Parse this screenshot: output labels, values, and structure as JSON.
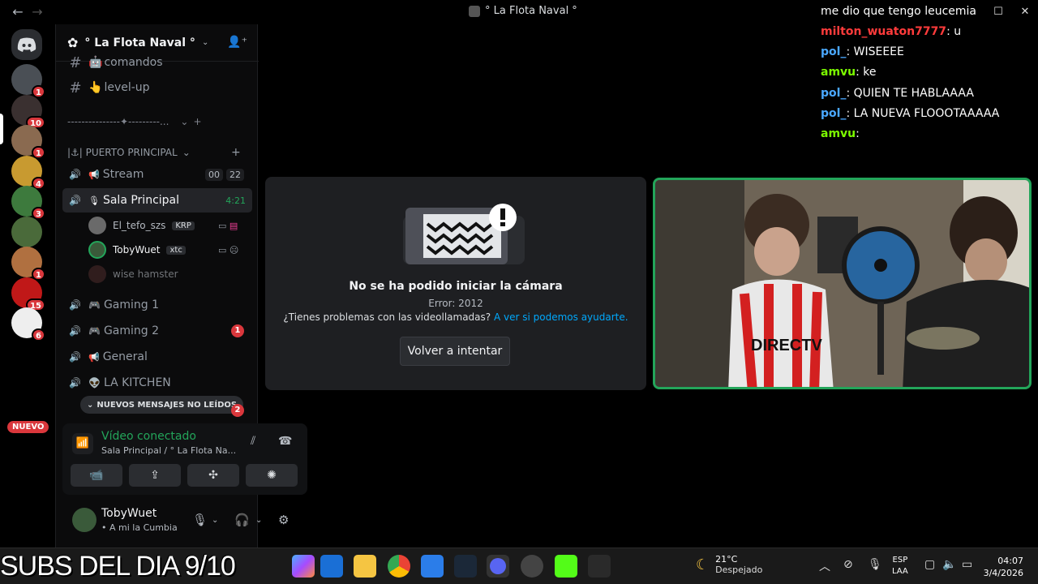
{
  "window": {
    "title": "° La Flota Naval °",
    "back": "←",
    "forward": "→",
    "minimize": "─",
    "maximize": "☐",
    "close": "✕"
  },
  "rail": {
    "home_icon": "discord-icon",
    "servers": [
      {
        "badge": "1",
        "color": "#4a4f55"
      },
      {
        "badge": "10",
        "color": "#3a3030"
      },
      {
        "badge": "1",
        "color": "#8a6a50"
      },
      {
        "badge": "4",
        "color": "#c89a30"
      },
      {
        "badge": "3",
        "color": "#3d7a3d"
      },
      {
        "badge": "",
        "color": "#4a6a3a"
      },
      {
        "badge": "1",
        "color": "#b07040"
      },
      {
        "badge": "15",
        "color": "#c01818"
      },
      {
        "badge": "6",
        "color": "#eeeeee"
      }
    ],
    "nuevo": "NUEVO"
  },
  "guild": {
    "name": "° La Flota Naval °",
    "chevron": "⌄",
    "invite_icon": "add-user-icon"
  },
  "channels": {
    "text": [
      {
        "name": "comandos",
        "emoji": "🤖"
      },
      {
        "name": "level-up",
        "emoji": "👆"
      }
    ],
    "divider": "---------------✦---------...",
    "category": "|⚓| PUERTO PRINCIPAL",
    "category_chevron": "⌄",
    "voice": [
      {
        "name": "Stream",
        "emoji": "📢",
        "count_a": "00",
        "count_b": "22"
      },
      {
        "name": "Sala Principal",
        "emoji": "🎙",
        "timer": "4:21"
      },
      {
        "name": "Gaming 1",
        "emoji": "🎮"
      },
      {
        "name": "Gaming 2",
        "emoji": "🎮",
        "badge": "1"
      },
      {
        "name": "General",
        "emoji": "📢"
      },
      {
        "name": "LA KITCHEN",
        "emoji": "👽"
      }
    ],
    "voice_users": [
      {
        "name": "El_tefo_szs",
        "tag": "KRP"
      },
      {
        "name": "TobyWuet",
        "tag": "xtc"
      },
      {
        "name": "wise hamster",
        "tag": ""
      }
    ],
    "new_messages": "NUEVOS MENSAJES NO LEÍDOS",
    "new_messages_badge": "2"
  },
  "voice_panel": {
    "status": "Vídeo conectado",
    "location": "Sala Principal / ° La Flota Na...",
    "buttons": [
      "📹",
      "⇪",
      "✣",
      "✺"
    ]
  },
  "user_panel": {
    "name": "TobyWuet",
    "status": "• A mi la Cumbia"
  },
  "chat_overlay": [
    {
      "user": "",
      "text": "me dio que tengo leucemia",
      "color": "#ffffff"
    },
    {
      "user": "milton_wuaton7777",
      "text": ": u",
      "color": "#ff3b3b"
    },
    {
      "user": "pol_",
      "text": ": WISEEEE",
      "color": "#4aa8ff"
    },
    {
      "user": "amvu",
      "text": ": ke",
      "color": "#7CFC00"
    },
    {
      "user": "pol_",
      "text": ": QUIEN TE HABLAAAA",
      "color": "#4aa8ff"
    },
    {
      "user": "pol_",
      "text": ": LA NUEVA FLOOOTAAAAA",
      "color": "#4aa8ff"
    },
    {
      "user": "amvu",
      "text": ":",
      "color": "#7CFC00"
    }
  ],
  "camera_error": {
    "title": "No se ha podido iniciar la cámara",
    "code": "Error: 2012",
    "help_text": "¿Tienes problemas con las videollamadas?",
    "help_link": "A ver si podemos ayudarte.",
    "retry": "Volver a intentar"
  },
  "overlay_text": "SUBS DEL DIA 9/10",
  "taskbar": {
    "weather_temp": "21°C",
    "weather_desc": "Despejado",
    "lang_1": "ESP",
    "lang_2": "LAA",
    "time": "04:07",
    "date": "3/4/2026"
  }
}
